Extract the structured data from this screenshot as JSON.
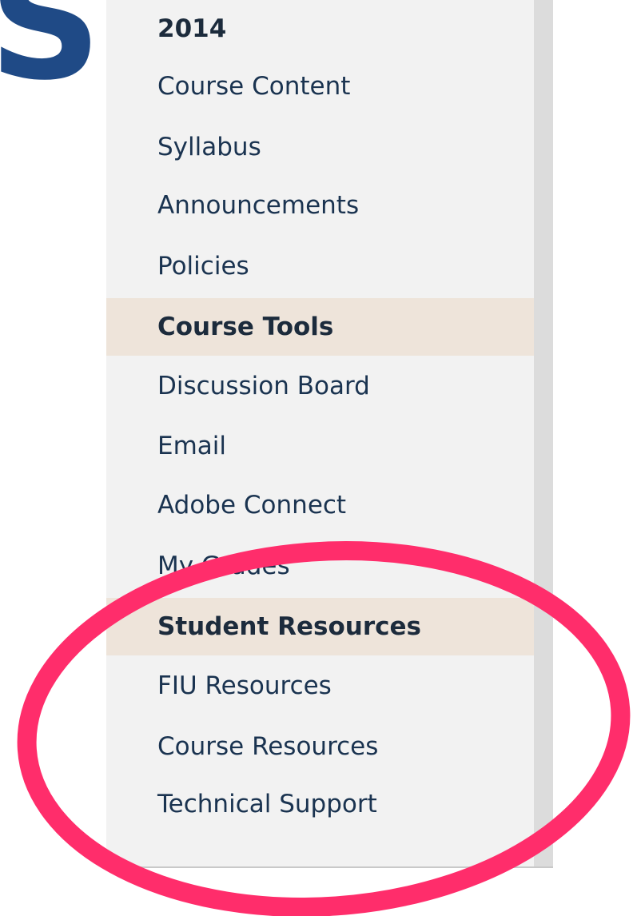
{
  "brand": {
    "letter": "S",
    "color": "#1f4a86"
  },
  "sidebar": {
    "background": "#f2f2f2",
    "header_background": "#eee4da",
    "text_color": "#1a3350",
    "course_title_fragment": "2014",
    "items": [
      {
        "label": "Course Content",
        "kind": "link"
      },
      {
        "label": "Syllabus",
        "kind": "link"
      },
      {
        "label": "Announcements",
        "kind": "link"
      },
      {
        "label": "Policies",
        "kind": "link"
      },
      {
        "label": "Course Tools",
        "kind": "header"
      },
      {
        "label": "Discussion Board",
        "kind": "link"
      },
      {
        "label": "Email",
        "kind": "link"
      },
      {
        "label": "Adobe Connect",
        "kind": "link"
      },
      {
        "label": "My Grades",
        "kind": "link"
      },
      {
        "label": "Student Resources",
        "kind": "header"
      },
      {
        "label": "FIU Resources",
        "kind": "link"
      },
      {
        "label": "Course Resources",
        "kind": "link"
      },
      {
        "label": "Technical Support",
        "kind": "link"
      }
    ]
  },
  "annotation": {
    "shape": "ellipse",
    "color": "#ff2d6b"
  }
}
